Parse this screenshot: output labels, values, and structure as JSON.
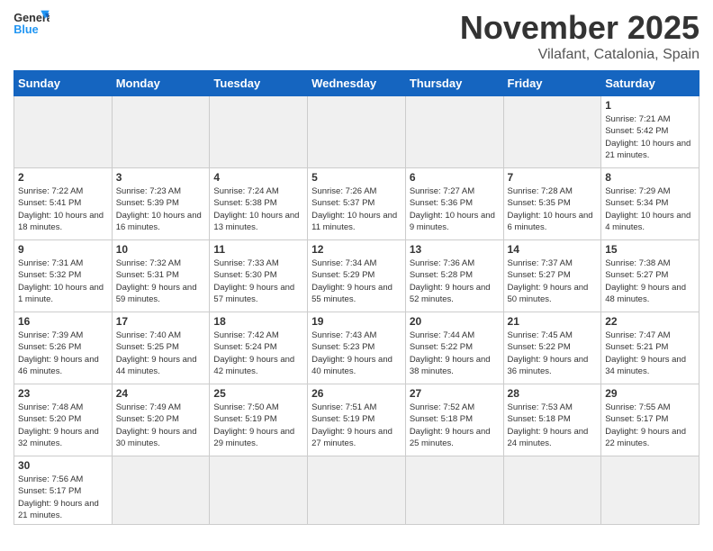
{
  "logo": {
    "general": "General",
    "blue": "Blue"
  },
  "header": {
    "month": "November 2025",
    "location": "Vilafant, Catalonia, Spain"
  },
  "weekdays": [
    "Sunday",
    "Monday",
    "Tuesday",
    "Wednesday",
    "Thursday",
    "Friday",
    "Saturday"
  ],
  "weeks": [
    [
      {
        "day": "",
        "info": "",
        "gray": true
      },
      {
        "day": "",
        "info": "",
        "gray": true
      },
      {
        "day": "",
        "info": "",
        "gray": true
      },
      {
        "day": "",
        "info": "",
        "gray": true
      },
      {
        "day": "",
        "info": "",
        "gray": true
      },
      {
        "day": "",
        "info": "",
        "gray": true
      },
      {
        "day": "1",
        "info": "Sunrise: 7:21 AM\nSunset: 5:42 PM\nDaylight: 10 hours and 21 minutes.",
        "gray": false
      }
    ],
    [
      {
        "day": "2",
        "info": "Sunrise: 7:22 AM\nSunset: 5:41 PM\nDaylight: 10 hours and 18 minutes.",
        "gray": false
      },
      {
        "day": "3",
        "info": "Sunrise: 7:23 AM\nSunset: 5:39 PM\nDaylight: 10 hours and 16 minutes.",
        "gray": false
      },
      {
        "day": "4",
        "info": "Sunrise: 7:24 AM\nSunset: 5:38 PM\nDaylight: 10 hours and 13 minutes.",
        "gray": false
      },
      {
        "day": "5",
        "info": "Sunrise: 7:26 AM\nSunset: 5:37 PM\nDaylight: 10 hours and 11 minutes.",
        "gray": false
      },
      {
        "day": "6",
        "info": "Sunrise: 7:27 AM\nSunset: 5:36 PM\nDaylight: 10 hours and 9 minutes.",
        "gray": false
      },
      {
        "day": "7",
        "info": "Sunrise: 7:28 AM\nSunset: 5:35 PM\nDaylight: 10 hours and 6 minutes.",
        "gray": false
      },
      {
        "day": "8",
        "info": "Sunrise: 7:29 AM\nSunset: 5:34 PM\nDaylight: 10 hours and 4 minutes.",
        "gray": false
      }
    ],
    [
      {
        "day": "9",
        "info": "Sunrise: 7:31 AM\nSunset: 5:32 PM\nDaylight: 10 hours and 1 minute.",
        "gray": false
      },
      {
        "day": "10",
        "info": "Sunrise: 7:32 AM\nSunset: 5:31 PM\nDaylight: 9 hours and 59 minutes.",
        "gray": false
      },
      {
        "day": "11",
        "info": "Sunrise: 7:33 AM\nSunset: 5:30 PM\nDaylight: 9 hours and 57 minutes.",
        "gray": false
      },
      {
        "day": "12",
        "info": "Sunrise: 7:34 AM\nSunset: 5:29 PM\nDaylight: 9 hours and 55 minutes.",
        "gray": false
      },
      {
        "day": "13",
        "info": "Sunrise: 7:36 AM\nSunset: 5:28 PM\nDaylight: 9 hours and 52 minutes.",
        "gray": false
      },
      {
        "day": "14",
        "info": "Sunrise: 7:37 AM\nSunset: 5:27 PM\nDaylight: 9 hours and 50 minutes.",
        "gray": false
      },
      {
        "day": "15",
        "info": "Sunrise: 7:38 AM\nSunset: 5:27 PM\nDaylight: 9 hours and 48 minutes.",
        "gray": false
      }
    ],
    [
      {
        "day": "16",
        "info": "Sunrise: 7:39 AM\nSunset: 5:26 PM\nDaylight: 9 hours and 46 minutes.",
        "gray": false
      },
      {
        "day": "17",
        "info": "Sunrise: 7:40 AM\nSunset: 5:25 PM\nDaylight: 9 hours and 44 minutes.",
        "gray": false
      },
      {
        "day": "18",
        "info": "Sunrise: 7:42 AM\nSunset: 5:24 PM\nDaylight: 9 hours and 42 minutes.",
        "gray": false
      },
      {
        "day": "19",
        "info": "Sunrise: 7:43 AM\nSunset: 5:23 PM\nDaylight: 9 hours and 40 minutes.",
        "gray": false
      },
      {
        "day": "20",
        "info": "Sunrise: 7:44 AM\nSunset: 5:22 PM\nDaylight: 9 hours and 38 minutes.",
        "gray": false
      },
      {
        "day": "21",
        "info": "Sunrise: 7:45 AM\nSunset: 5:22 PM\nDaylight: 9 hours and 36 minutes.",
        "gray": false
      },
      {
        "day": "22",
        "info": "Sunrise: 7:47 AM\nSunset: 5:21 PM\nDaylight: 9 hours and 34 minutes.",
        "gray": false
      }
    ],
    [
      {
        "day": "23",
        "info": "Sunrise: 7:48 AM\nSunset: 5:20 PM\nDaylight: 9 hours and 32 minutes.",
        "gray": false
      },
      {
        "day": "24",
        "info": "Sunrise: 7:49 AM\nSunset: 5:20 PM\nDaylight: 9 hours and 30 minutes.",
        "gray": false
      },
      {
        "day": "25",
        "info": "Sunrise: 7:50 AM\nSunset: 5:19 PM\nDaylight: 9 hours and 29 minutes.",
        "gray": false
      },
      {
        "day": "26",
        "info": "Sunrise: 7:51 AM\nSunset: 5:19 PM\nDaylight: 9 hours and 27 minutes.",
        "gray": false
      },
      {
        "day": "27",
        "info": "Sunrise: 7:52 AM\nSunset: 5:18 PM\nDaylight: 9 hours and 25 minutes.",
        "gray": false
      },
      {
        "day": "28",
        "info": "Sunrise: 7:53 AM\nSunset: 5:18 PM\nDaylight: 9 hours and 24 minutes.",
        "gray": false
      },
      {
        "day": "29",
        "info": "Sunrise: 7:55 AM\nSunset: 5:17 PM\nDaylight: 9 hours and 22 minutes.",
        "gray": false
      }
    ],
    [
      {
        "day": "30",
        "info": "Sunrise: 7:56 AM\nSunset: 5:17 PM\nDaylight: 9 hours and 21 minutes.",
        "gray": false
      },
      {
        "day": "",
        "info": "",
        "gray": true
      },
      {
        "day": "",
        "info": "",
        "gray": true
      },
      {
        "day": "",
        "info": "",
        "gray": true
      },
      {
        "day": "",
        "info": "",
        "gray": true
      },
      {
        "day": "",
        "info": "",
        "gray": true
      },
      {
        "day": "",
        "info": "",
        "gray": true
      }
    ]
  ]
}
